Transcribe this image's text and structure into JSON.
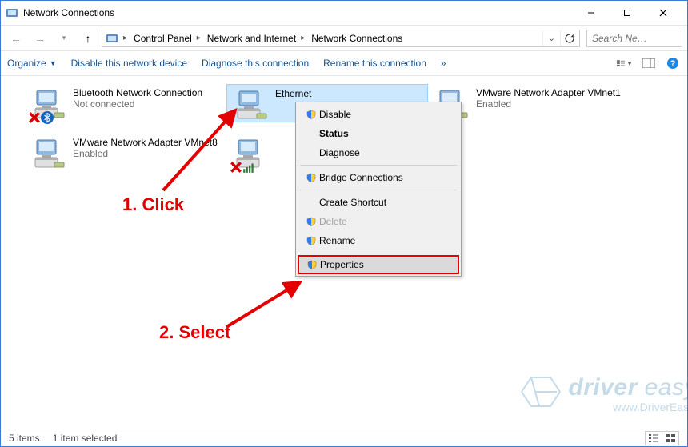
{
  "window": {
    "title": "Network Connections"
  },
  "breadcrumbs": [
    "Control Panel",
    "Network and Internet",
    "Network Connections"
  ],
  "search": {
    "placeholder": "Search Ne…"
  },
  "toolbar": {
    "organize": "Organize",
    "disable": "Disable this network device",
    "diagnose": "Diagnose this connection",
    "rename": "Rename this connection",
    "overflow": "»"
  },
  "items": [
    {
      "name": "Bluetooth Network Connection",
      "line2": "Not connected",
      "line3": "",
      "state": "off-bt"
    },
    {
      "name": "Ethernet",
      "line2": "",
      "line3": "",
      "state": "selected"
    },
    {
      "name": "VMware Network Adapter VMnet1",
      "line2": "Enabled",
      "line3": "",
      "state": "ok"
    },
    {
      "name": "VMware Network Adapter VMnet8",
      "line2": "Enabled",
      "line3": "",
      "state": "ok"
    },
    {
      "name": "",
      "line2": "",
      "line3": "",
      "state": "off-bars"
    }
  ],
  "contextMenu": [
    {
      "label": "Disable",
      "icon": "shield"
    },
    {
      "label": "Status",
      "bold": true
    },
    {
      "label": "Diagnose"
    },
    {
      "sep": true
    },
    {
      "label": "Bridge Connections",
      "icon": "shield"
    },
    {
      "sep": true
    },
    {
      "label": "Create Shortcut"
    },
    {
      "label": "Delete",
      "icon": "shield",
      "disabled": true
    },
    {
      "label": "Rename",
      "icon": "shield"
    },
    {
      "sep": true
    },
    {
      "label": "Properties",
      "icon": "shield",
      "highlight": true
    }
  ],
  "annotations": {
    "click": "1. Click",
    "select": "2. Select"
  },
  "watermark": {
    "brand_strong": "driver",
    "brand_rest": " easy",
    "url": "www.DriverEasy."
  },
  "statusbar": {
    "count": "5 items",
    "sel": "1 item selected"
  }
}
